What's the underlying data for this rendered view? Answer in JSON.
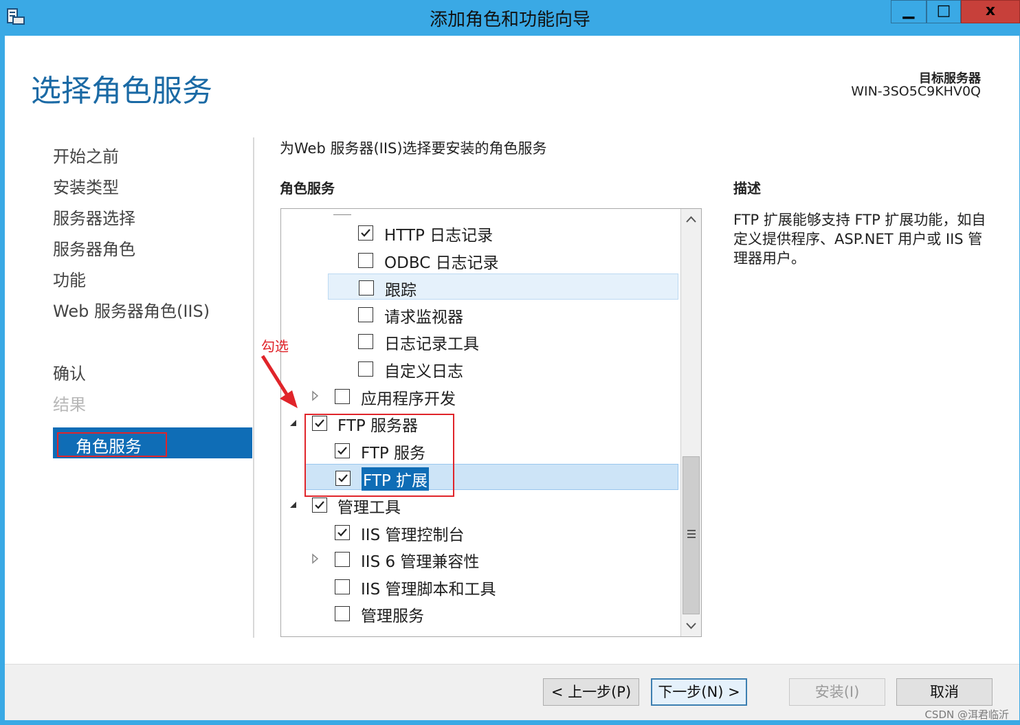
{
  "window": {
    "title": "添加角色和功能向导",
    "minimize_glyph": "▁",
    "maximize_glyph": "□",
    "close_glyph": "x"
  },
  "page": {
    "heading": "选择角色服务",
    "target_server_label": "目标服务器",
    "target_server_name": "WIN-3SO5C9KHV0Q"
  },
  "nav": {
    "items": [
      {
        "label": "开始之前",
        "state": "normal"
      },
      {
        "label": "安装类型",
        "state": "normal"
      },
      {
        "label": "服务器选择",
        "state": "normal"
      },
      {
        "label": "服务器角色",
        "state": "normal"
      },
      {
        "label": "功能",
        "state": "normal"
      },
      {
        "label": "Web 服务器角色(IIS)",
        "state": "normal"
      },
      {
        "label": "角色服务",
        "state": "active"
      },
      {
        "label": "确认",
        "state": "normal"
      },
      {
        "label": "结果",
        "state": "disabled"
      }
    ]
  },
  "content": {
    "instruction": "为Web 服务器(IIS)选择要安装的角色服务",
    "roles_header": "角色服务",
    "description_header": "描述",
    "description": "FTP 扩展能够支持 FTP 扩展功能，如自定义提供程序、ASP.NET 用户或 IIS 管理器用户。"
  },
  "tree": {
    "items": [
      {
        "label": "HTTP 日志记录",
        "checked": true,
        "level": 3,
        "expander": "none",
        "state": "normal"
      },
      {
        "label": "ODBC 日志记录",
        "checked": false,
        "level": 3,
        "expander": "none",
        "state": "normal"
      },
      {
        "label": "跟踪",
        "checked": false,
        "level": 3,
        "expander": "none",
        "state": "hover"
      },
      {
        "label": "请求监视器",
        "checked": false,
        "level": 3,
        "expander": "none",
        "state": "normal"
      },
      {
        "label": "日志记录工具",
        "checked": false,
        "level": 3,
        "expander": "none",
        "state": "normal"
      },
      {
        "label": "自定义日志",
        "checked": false,
        "level": 3,
        "expander": "none",
        "state": "normal"
      },
      {
        "label": "应用程序开发",
        "checked": false,
        "level": 2,
        "expander": "collapsed",
        "state": "normal"
      },
      {
        "label": "FTP 服务器",
        "checked": true,
        "level": 1,
        "expander": "expanded",
        "state": "normal"
      },
      {
        "label": "FTP 服务",
        "checked": true,
        "level": 2,
        "expander": "none",
        "state": "normal"
      },
      {
        "label": "FTP 扩展",
        "checked": true,
        "level": 2,
        "expander": "none",
        "state": "selected"
      },
      {
        "label": "管理工具",
        "checked": true,
        "level": 1,
        "expander": "expanded",
        "state": "normal"
      },
      {
        "label": "IIS 管理控制台",
        "checked": true,
        "level": 2,
        "expander": "none",
        "state": "normal"
      },
      {
        "label": "IIS 6 管理兼容性",
        "checked": false,
        "level": 2,
        "expander": "collapsed",
        "state": "normal"
      },
      {
        "label": "IIS 管理脚本和工具",
        "checked": false,
        "level": 2,
        "expander": "none",
        "state": "normal"
      },
      {
        "label": "管理服务",
        "checked": false,
        "level": 2,
        "expander": "none",
        "state": "normal"
      }
    ]
  },
  "annotation": {
    "label": "勾选",
    "color": "#e0242a"
  },
  "buttons": {
    "prev": "< 上一步(P)",
    "next": "下一步(N) >",
    "install": "安装(I)",
    "cancel": "取消"
  },
  "watermark": "CSDN @洱君临沂",
  "colors": {
    "titlebar": "#3aa9e5",
    "heading": "#1b6aa5",
    "nav_active": "#0f6db6",
    "close_button": "#c7403a",
    "annotation": "#e0242a"
  },
  "icons": {
    "app": "server-manager-icon",
    "check": "check-icon",
    "expand": "triangle-expander-icon",
    "scroll": "chevron-icon"
  }
}
